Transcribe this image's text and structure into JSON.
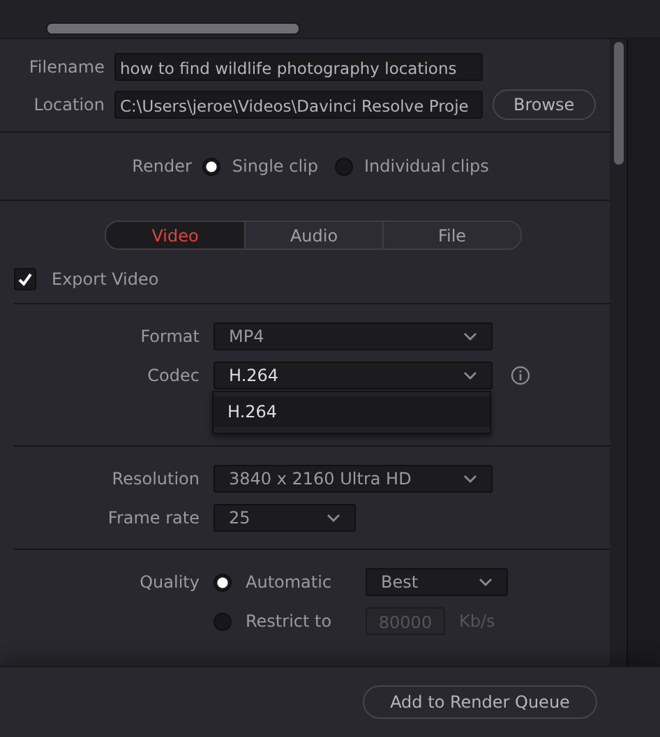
{
  "filename": {
    "label": "Filename",
    "value": "how to find wildlife photography locations"
  },
  "location": {
    "label": "Location",
    "value": "C:\\Users\\jeroe\\Videos\\Davinci Resolve Proje",
    "button": "Browse"
  },
  "render": {
    "label": "Render",
    "options": [
      {
        "label": "Single clip",
        "selected": true
      },
      {
        "label": "Individual clips",
        "selected": false
      }
    ]
  },
  "tabs": [
    {
      "label": "Video",
      "selected": true
    },
    {
      "label": "Audio",
      "selected": false
    },
    {
      "label": "File",
      "selected": false
    }
  ],
  "export_video": {
    "label": "Export Video",
    "checked": true
  },
  "format": {
    "label": "Format",
    "value": "MP4"
  },
  "codec": {
    "label": "Codec",
    "value": "H.264",
    "options": [
      "H.264"
    ]
  },
  "resolution": {
    "label": "Resolution",
    "value": "3840 x 2160 Ultra HD"
  },
  "frame_rate": {
    "label": "Frame rate",
    "value": "25"
  },
  "quality": {
    "label": "Quality",
    "options": [
      {
        "label": "Automatic",
        "selected": true,
        "kind": "dropdown",
        "value": "Best"
      },
      {
        "label": "Restrict to",
        "selected": false,
        "kind": "number",
        "value": "80000",
        "unit": "Kb/s",
        "disabled": true
      }
    ]
  },
  "footer_button": "Add to Render Queue"
}
